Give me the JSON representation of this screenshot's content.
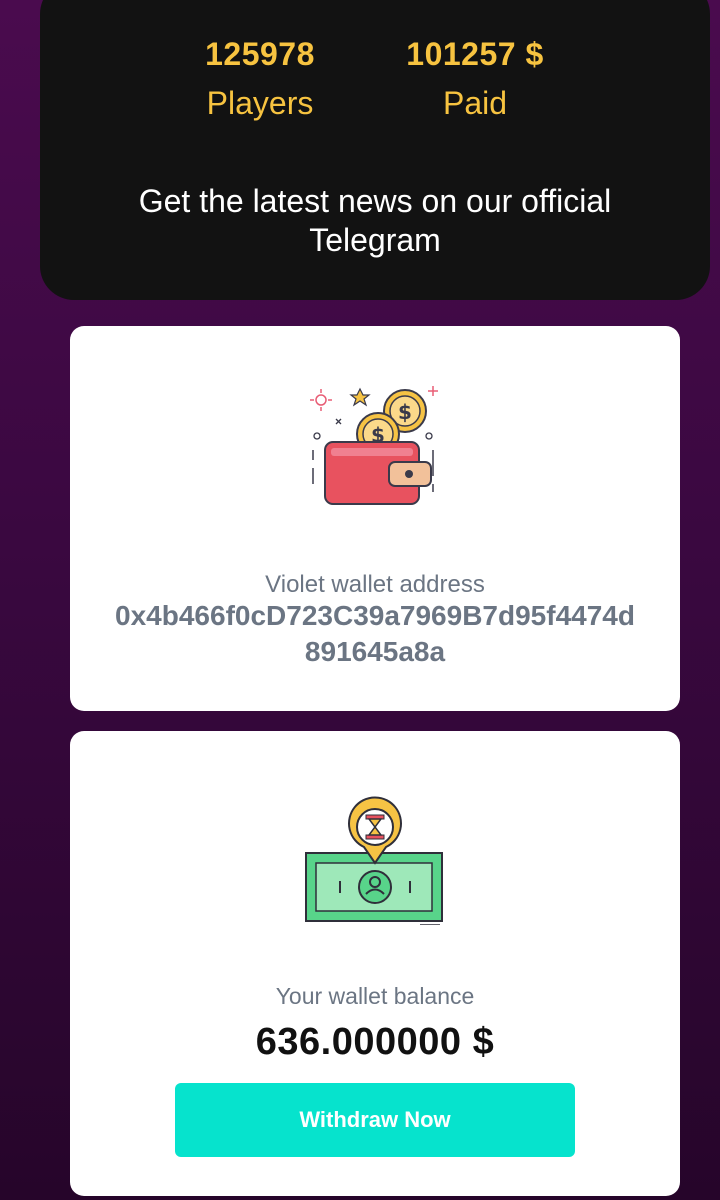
{
  "stats": {
    "players_count": "125978",
    "players_label": "Players",
    "paid_amount": "101257 $",
    "paid_label": "Paid"
  },
  "news": {
    "text": "Get the latest news on our official Telegram"
  },
  "wallet": {
    "icon": "wallet-with-coins-icon",
    "address_label": "Violet wallet address",
    "address": "0x4b466f0cD723C39a7969B7d95f4474d891645a8a"
  },
  "balance": {
    "icon": "banknote-hourglass-icon",
    "label": "Your wallet balance",
    "value": "636.000000 $",
    "withdraw_label": "Withdraw Now"
  },
  "colors": {
    "accent_gold": "#f7c340",
    "button_teal": "#06e3cd",
    "background_purple": "#3a0840"
  }
}
